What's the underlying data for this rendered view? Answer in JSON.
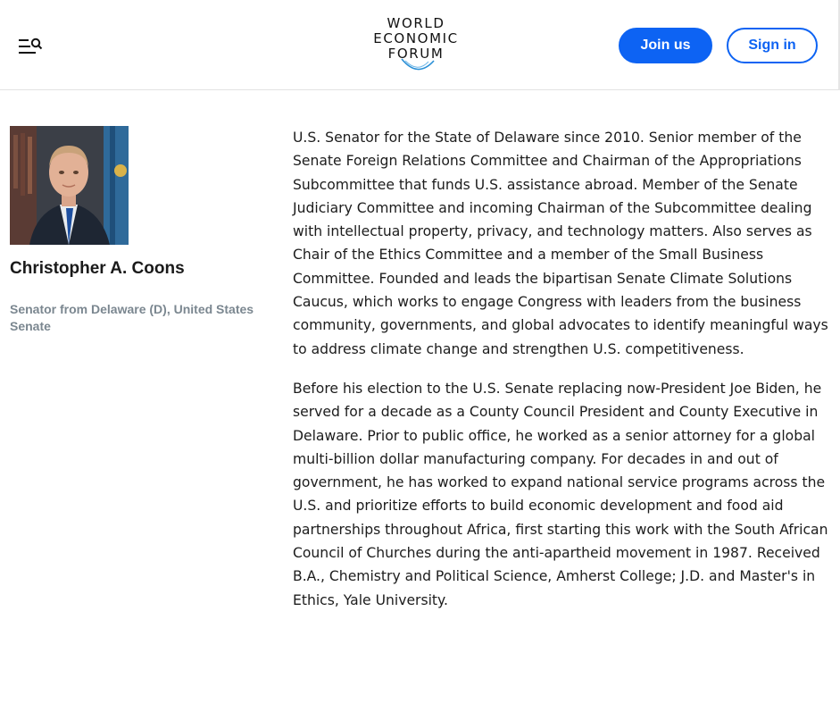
{
  "header": {
    "menu_icon": "menu-search-icon",
    "logo": [
      "WORLD",
      "ECONOMIC",
      "FORUM"
    ],
    "join_label": "Join us",
    "sign_in_label": "Sign in",
    "accent_color": "#0d63f3"
  },
  "profile": {
    "name": "Christopher A. Coons",
    "role": "Senator from Delaware (D), United States Senate",
    "bio": [
      "U.S. Senator for the State of Delaware since 2010. Senior member of the Senate Foreign Relations Committee and Chairman of the Appropriations Subcommittee that funds U.S. assistance abroad. Member of the Senate Judiciary Committee and incoming Chairman of the Subcommittee dealing with intellectual property, privacy, and technology matters. Also serves as Chair of the Ethics Committee and a member of the Small Business Committee. Founded and leads the bipartisan Senate Climate Solutions Caucus, which works to engage Congress with leaders from the business community, governments, and global advocates to identify meaningful ways to address climate change and strengthen U.S. competitiveness.",
      "Before his election to the U.S. Senate replacing now-President Joe Biden, he served for a decade as a County Council President and County Executive in Delaware. Prior to public office, he worked as a senior attorney for a global multi-billion dollar manufacturing company. For decades in and out of government, he has worked to expand national service programs across the U.S. and prioritize efforts to build economic development and food aid partnerships throughout Africa, first starting this work with the South African Council of Churches during the anti-apartheid movement in 1987. Received B.A., Chemistry and Political Science, Amherst College; J.D. and Master's in Ethics, Yale University."
    ]
  }
}
